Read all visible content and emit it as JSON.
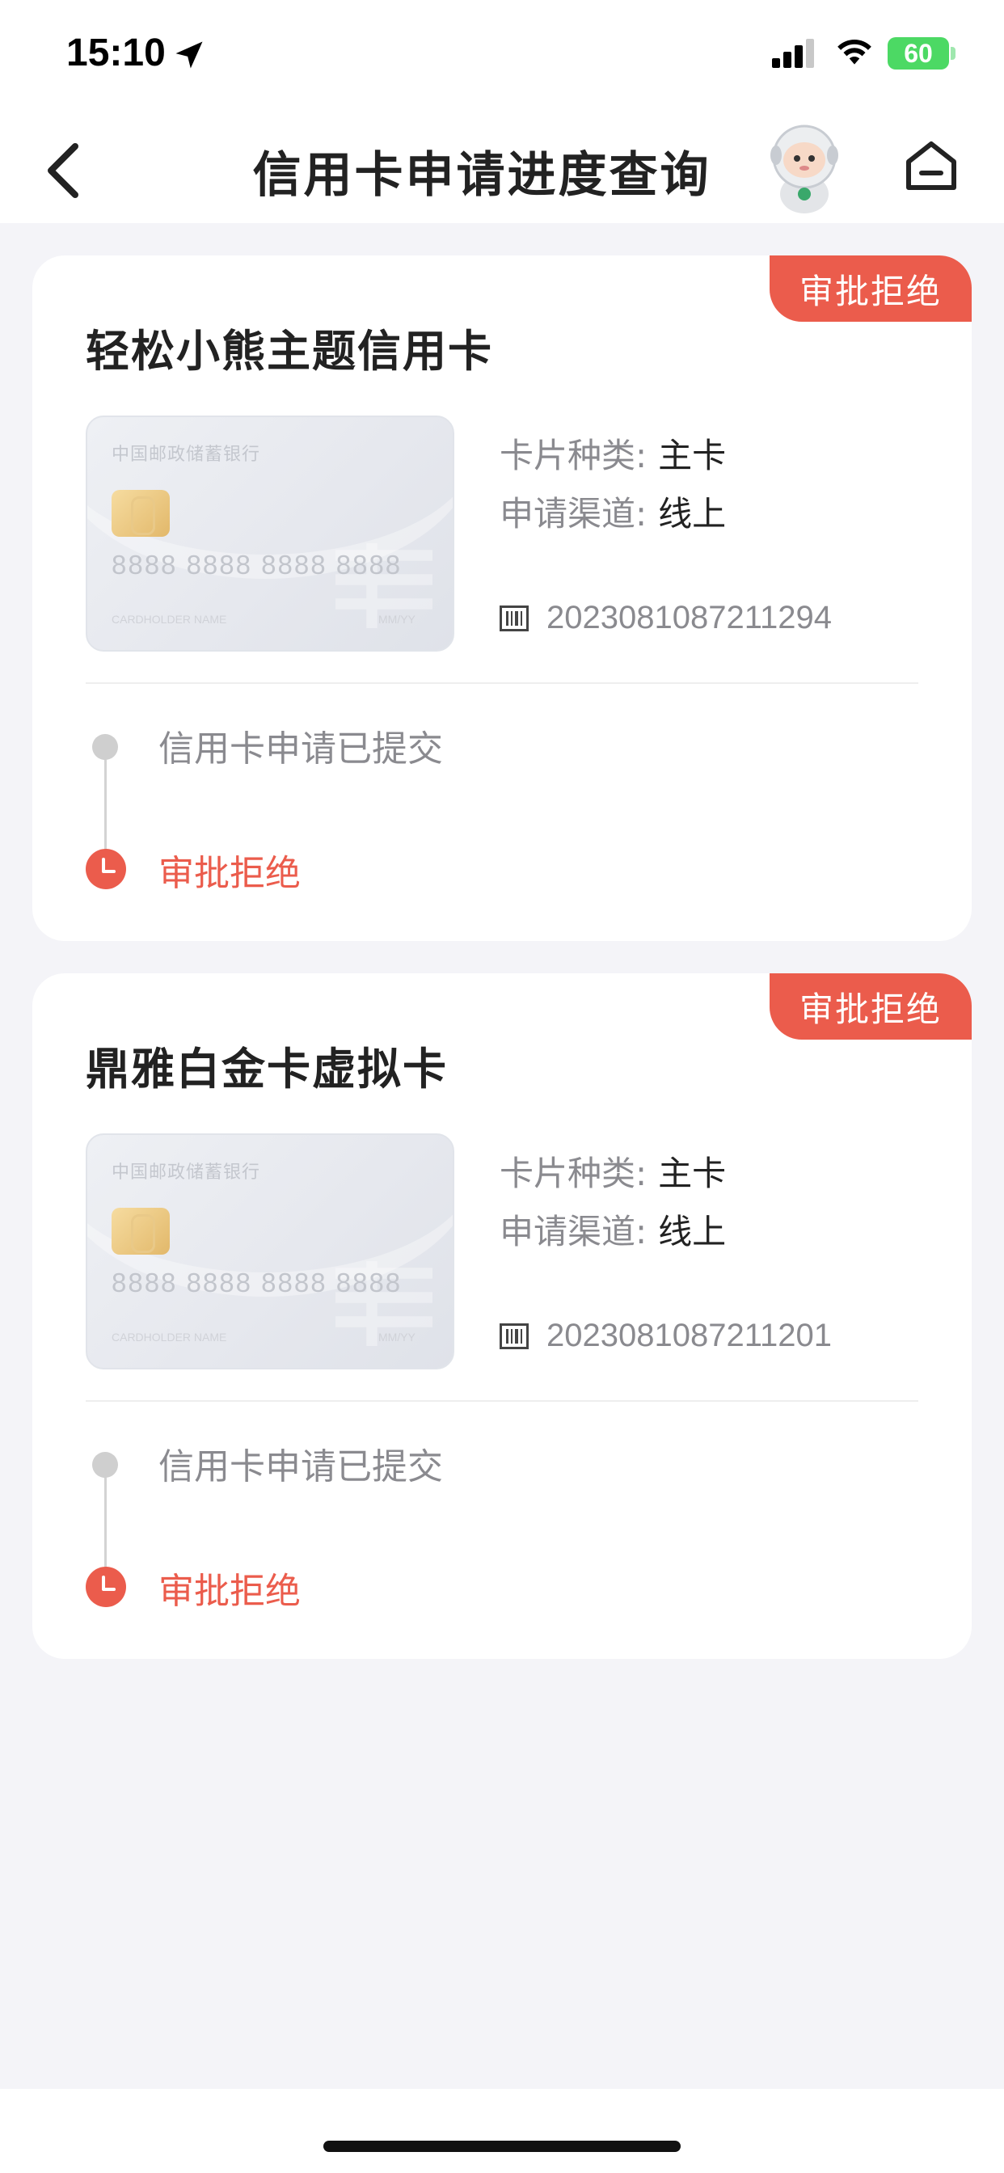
{
  "status_bar": {
    "time": "15:10",
    "battery": "60",
    "icons": [
      "location-arrow-icon",
      "cellular-signal-icon",
      "wifi-icon",
      "battery-charging-icon"
    ]
  },
  "nav": {
    "title": "信用卡申请进度查询",
    "icons": [
      "back-chevron-icon",
      "mascot-avatar-icon",
      "home-icon"
    ]
  },
  "labels": {
    "card_type": "卡片种类:",
    "channel": "申请渠道:",
    "step_submitted": "信用卡申请已提交"
  },
  "card_face": {
    "bank_name": "中国邮政储蓄银行",
    "number": "8888 8888 8888 8888",
    "holder": "CARDHOLDER NAME",
    "expiry": "MM/YY"
  },
  "applications": [
    {
      "status_tag": "审批拒绝",
      "title": "轻松小熊主题信用卡",
      "card_type": "主卡",
      "channel": "线上",
      "app_number": "2023081087211294",
      "current_step": "审批拒绝"
    },
    {
      "status_tag": "审批拒绝",
      "title": "鼎雅白金卡虚拟卡",
      "card_type": "主卡",
      "channel": "线上",
      "app_number": "2023081087211201",
      "current_step": "审批拒绝"
    }
  ],
  "colors": {
    "accent_red": "#eb5c4c",
    "background": "#f4f4f8",
    "battery_green": "#4cd964"
  }
}
